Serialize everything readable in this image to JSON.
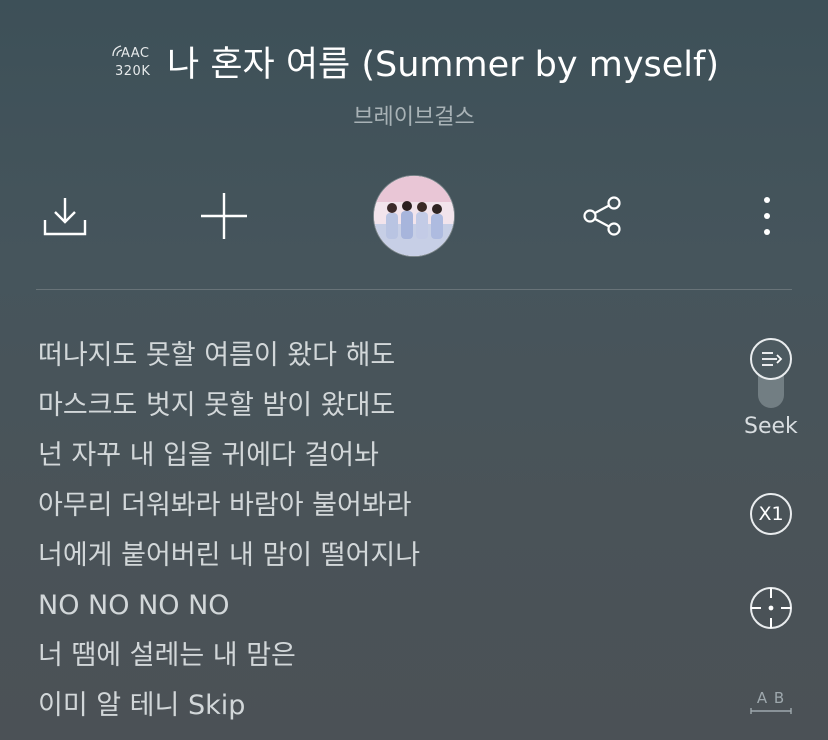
{
  "header": {
    "quality_codec": "AAC",
    "quality_bitrate": "320K",
    "title": "나 혼자 여름 (Summer by myself)",
    "artist": "브레이브걸스"
  },
  "actions": {
    "download_icon": "download-icon",
    "add_icon": "plus-icon",
    "share_icon": "share-icon",
    "more_icon": "more-vertical-icon"
  },
  "lyrics": [
    "떠나지도 못할 여름이 왔다 해도",
    "마스크도 벗지 못할 밤이 왔대도",
    "넌 자꾸 내 입을 귀에다 걸어놔",
    "아무리 더워봐라 바람아 불어봐라",
    "너에게 붙어버린 내 맘이 떨어지나",
    "NO NO NO NO",
    "너 땜에 설레는 내 맘은",
    "이미 알 테니 Skip"
  ],
  "side_controls": {
    "seek_label": "Seek",
    "speed_label": "X1",
    "locate_icon": "crosshair-icon",
    "translate_icon": "ab-text-icon",
    "translate_label": "A B"
  }
}
